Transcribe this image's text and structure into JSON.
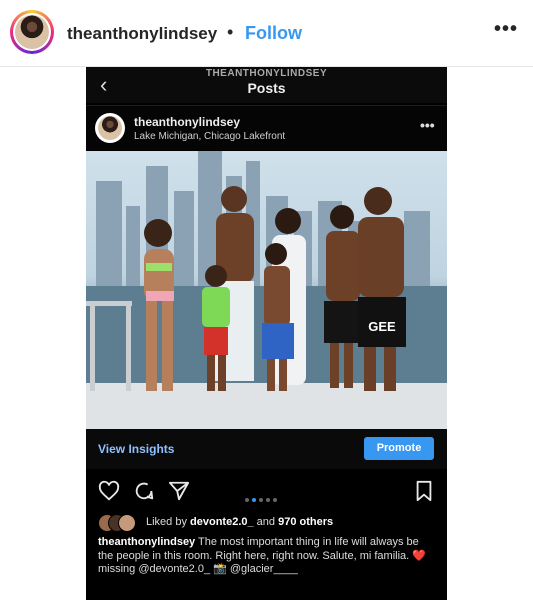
{
  "outer": {
    "username": "theanthonylindsey",
    "dot": "•",
    "follow_label": "Follow",
    "more_label": "•••"
  },
  "phone": {
    "back_glyph": "‹",
    "kicker": "THEANTHONYLINDSEY",
    "title": "Posts",
    "post": {
      "username": "theanthonylindsey",
      "location": "Lake Michigan, Chicago Lakefront",
      "more_label": "•••"
    },
    "photo_text": {
      "swim_trunks_text": "GEE"
    },
    "insights_label": "View Insights",
    "promote_label": "Promote",
    "carousel": {
      "count": 5,
      "active": 1
    },
    "likes": {
      "prefix": "Liked by ",
      "user": "devonte2.0_",
      "middle": " and ",
      "count": "970 others"
    },
    "caption": {
      "user": "theanthonylindsey",
      "text": " The most important thing in life will always be the people in this room. Right here, right now. Salute, mi familia. ❤️ missing @devonte2.0_ 📸 @glacier____"
    },
    "colors": {
      "follow": "#3897f0",
      "promote": "#3897f0",
      "insights": "#8ec0ff",
      "heart": "#e0245e"
    }
  }
}
